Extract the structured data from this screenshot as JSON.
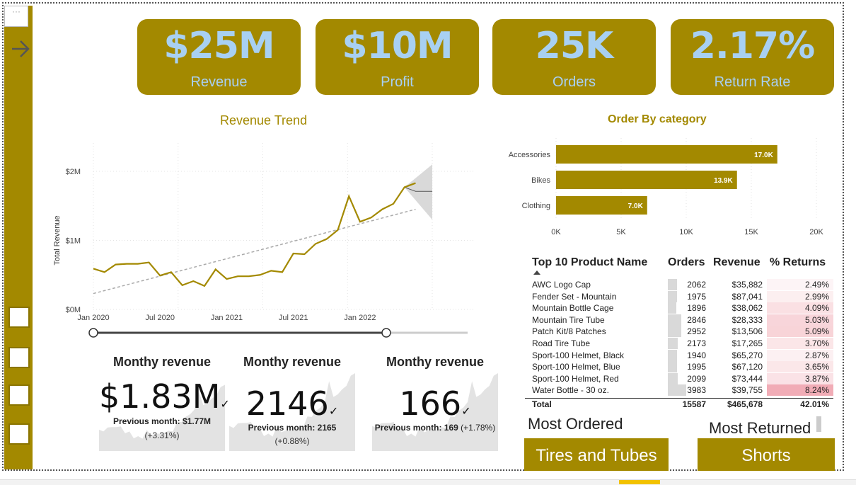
{
  "kpis": [
    {
      "value": "$25M",
      "label": "Revenue"
    },
    {
      "value": "$10M",
      "label": "Profit"
    },
    {
      "value": "25K",
      "label": "Orders"
    },
    {
      "value": "2.17%",
      "label": "Return Rate"
    }
  ],
  "colors": {
    "accent": "#a38900",
    "kpi_text": "#a8d0f2",
    "forecast": "#d9d9d9",
    "returns_high": "#f4b6bd"
  },
  "icons": {
    "sidebar_arrow": "arrow-right-icon",
    "checkbox": "checkbox-icon",
    "top": "back-icon"
  },
  "chart_data": [
    {
      "type": "line",
      "title": "Revenue Trend",
      "ylabel": "Total Revenue",
      "xlabel": "",
      "x_ticks": [
        "Jan 2020",
        "Jul 2020",
        "Jan 2021",
        "Jul 2021",
        "Jan 2022"
      ],
      "y_ticks": [
        "$0M",
        "$1M",
        "$2M"
      ],
      "ylim": [
        0,
        2.0
      ],
      "x": [
        "2020-01",
        "2020-02",
        "2020-03",
        "2020-04",
        "2020-05",
        "2020-06",
        "2020-07",
        "2020-08",
        "2020-09",
        "2020-10",
        "2020-11",
        "2020-12",
        "2021-01",
        "2021-02",
        "2021-03",
        "2021-04",
        "2021-05",
        "2021-06",
        "2021-07",
        "2021-08",
        "2021-09",
        "2021-10",
        "2021-11",
        "2021-12",
        "2022-01",
        "2022-02",
        "2022-03",
        "2022-04",
        "2022-05",
        "2022-06"
      ],
      "series": [
        {
          "values": [
            0.59,
            0.54,
            0.65,
            0.66,
            0.66,
            0.68,
            0.49,
            0.54,
            0.35,
            0.41,
            0.34,
            0.58,
            0.44,
            0.48,
            0.48,
            0.5,
            0.56,
            0.54,
            0.81,
            0.8,
            0.95,
            1.02,
            1.15,
            1.64,
            1.27,
            1.33,
            1.45,
            1.53,
            1.77,
            1.83
          ]
        }
      ],
      "trendline": {
        "start": 0.23,
        "end": 1.45
      },
      "forecast": {
        "upper_end": 2.1,
        "lower_end": 1.3,
        "center_end": 1.71
      },
      "grid": true
    },
    {
      "type": "bar",
      "orientation": "horizontal",
      "title": "Order By category",
      "categories": [
        "Accessories",
        "Bikes",
        "Clothing"
      ],
      "values": [
        17000,
        13900,
        7000
      ],
      "data_labels": [
        "17.0K",
        "13.9K",
        "7.0K"
      ],
      "x_ticks": [
        "0K",
        "5K",
        "10K",
        "15K",
        "20K"
      ],
      "xlim": [
        0,
        20000
      ],
      "grid": true
    }
  ],
  "cards": [
    {
      "title": "Monthy revenue",
      "value": "$1.83M",
      "prev_label": "Previous month: ",
      "prev_value": "$1.77M",
      "delta": "(+3.31%)"
    },
    {
      "title": "Monthy revenue",
      "value": "2146",
      "prev_label": "Previous month: ",
      "prev_value": "2165",
      "delta": "(+0.88%)"
    },
    {
      "title": "Monthy revenue",
      "value": "166",
      "prev_label": "Previous month: ",
      "prev_value": "169",
      "delta": "(+1.78%)"
    }
  ],
  "table": {
    "headers": [
      "Top 10 Product Name",
      "Orders",
      "Revenue",
      "% Returns"
    ],
    "rows": [
      {
        "name": "AWC Logo Cap",
        "orders": "2062",
        "revenue": "$35,882",
        "returns": "2.49%",
        "orders_num": 2062,
        "returns_num": 2.49
      },
      {
        "name": "Fender Set - Mountain",
        "orders": "1975",
        "revenue": "$87,041",
        "returns": "2.99%",
        "orders_num": 1975,
        "returns_num": 2.99
      },
      {
        "name": "Mountain Bottle Cage",
        "orders": "1896",
        "revenue": "$38,062",
        "returns": "4.09%",
        "orders_num": 1896,
        "returns_num": 4.09
      },
      {
        "name": "Mountain Tire Tube",
        "orders": "2846",
        "revenue": "$28,333",
        "returns": "5.03%",
        "orders_num": 2846,
        "returns_num": 5.03
      },
      {
        "name": "Patch Kit/8 Patches",
        "orders": "2952",
        "revenue": "$13,506",
        "returns": "5.09%",
        "orders_num": 2952,
        "returns_num": 5.09
      },
      {
        "name": "Road Tire Tube",
        "orders": "2173",
        "revenue": "$17,265",
        "returns": "3.70%",
        "orders_num": 2173,
        "returns_num": 3.7
      },
      {
        "name": "Sport-100 Helmet, Black",
        "orders": "1940",
        "revenue": "$65,270",
        "returns": "2.87%",
        "orders_num": 1940,
        "returns_num": 2.87
      },
      {
        "name": "Sport-100 Helmet, Blue",
        "orders": "1995",
        "revenue": "$67,120",
        "returns": "3.65%",
        "orders_num": 1995,
        "returns_num": 3.65
      },
      {
        "name": "Sport-100 Helmet, Red",
        "orders": "2099",
        "revenue": "$73,444",
        "returns": "3.87%",
        "orders_num": 2099,
        "returns_num": 3.87
      },
      {
        "name": "Water Bottle - 30 oz.",
        "orders": "3983",
        "revenue": "$39,755",
        "returns": "8.24%",
        "orders_num": 3983,
        "returns_num": 8.24
      }
    ],
    "total": {
      "label": "Total",
      "orders": "15587",
      "revenue": "$465,678",
      "returns": "42.01%"
    }
  },
  "most_ordered": {
    "label": "Most Ordered",
    "value": "Tires and Tubes"
  },
  "most_returned": {
    "label": "Most Returned",
    "value": "Shorts"
  }
}
